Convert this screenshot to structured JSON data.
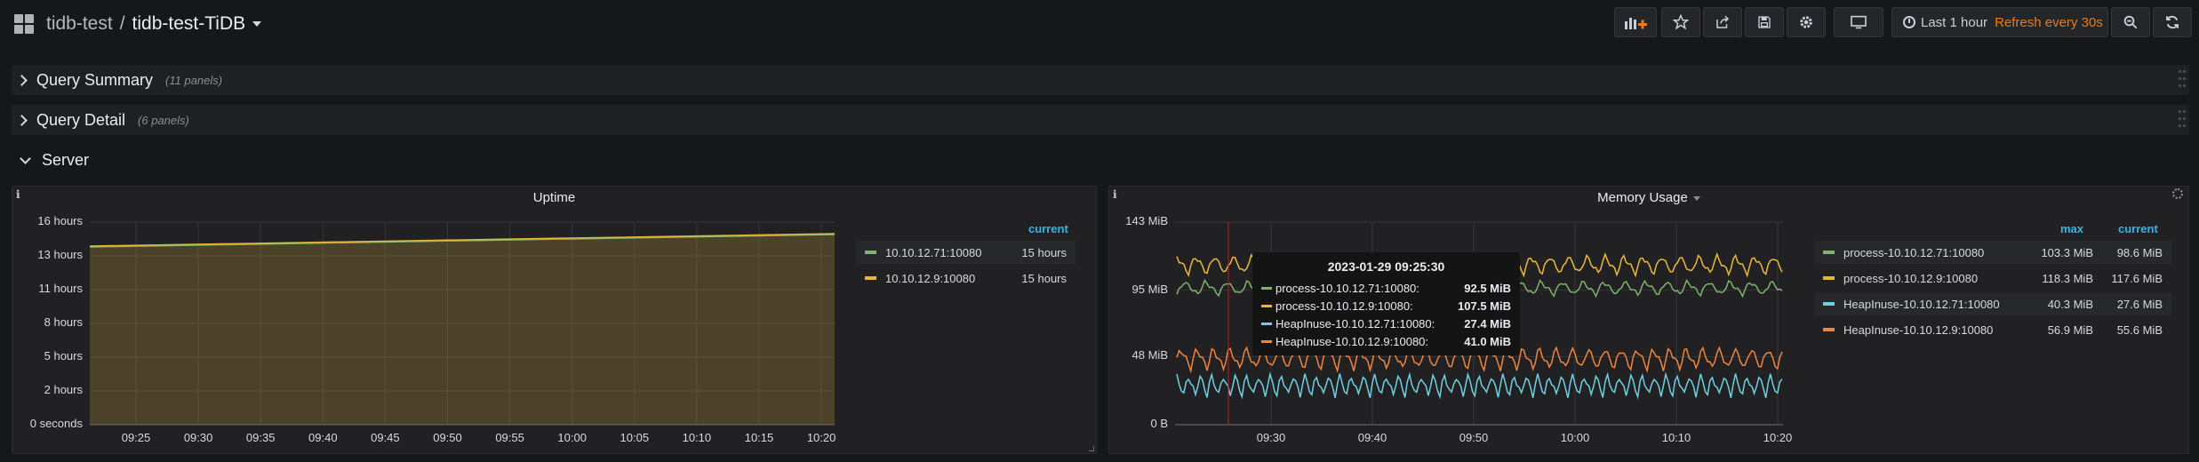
{
  "navbar": {
    "folder": "tidb-test",
    "separator": "/",
    "dashboard": "tidb-test-TiDB",
    "time_range": "Last 1 hour",
    "refresh": "Refresh every 30s",
    "buttons": [
      "add-panel-icon",
      "star-icon",
      "share-icon",
      "save-icon",
      "gear-icon",
      "tv-icon",
      "zoom-out-icon",
      "refresh-icon"
    ]
  },
  "rows": [
    {
      "title": "Query Summary",
      "count": "(11 panels)",
      "collapsed": true
    },
    {
      "title": "Query Detail",
      "count": "(6 panels)",
      "collapsed": true
    },
    {
      "title": "Server",
      "count": "",
      "collapsed": false
    }
  ],
  "uptime_panel": {
    "info": "i",
    "title": "Uptime",
    "legend_header": "current",
    "legend": [
      {
        "name": "10.10.12.71:10080",
        "current": "15 hours",
        "color": "#7eb26d"
      },
      {
        "name": "10.10.12.9:10080",
        "current": "15 hours",
        "color": "#eab839"
      }
    ],
    "y_ticks": [
      "16 hours",
      "13 hours",
      "11 hours",
      "8 hours",
      "5 hours",
      "2 hours",
      "0 seconds"
    ],
    "x_ticks": [
      "09:25",
      "09:30",
      "09:35",
      "09:40",
      "09:45",
      "09:50",
      "09:55",
      "10:00",
      "10:05",
      "10:10",
      "10:15",
      "10:20"
    ]
  },
  "memory_panel": {
    "info": "i",
    "title": "Memory Usage",
    "legend_headers": {
      "max": "max",
      "current": "current"
    },
    "legend": [
      {
        "name": "process-10.10.12.71:10080",
        "max": "103.3 MiB",
        "current": "98.6 MiB",
        "color": "#7eb26d"
      },
      {
        "name": "process-10.10.12.9:10080",
        "max": "118.3 MiB",
        "current": "117.6 MiB",
        "color": "#eab839"
      },
      {
        "name": "HeapInuse-10.10.12.71:10080",
        "max": "40.3 MiB",
        "current": "27.6 MiB",
        "color": "#6ed0e0"
      },
      {
        "name": "HeapInuse-10.10.12.9:10080",
        "max": "56.9 MiB",
        "current": "55.6 MiB",
        "color": "#ef843c"
      }
    ],
    "y_ticks": [
      "143 MiB",
      "95 MiB",
      "48 MiB",
      "0 B"
    ],
    "x_ticks": [
      "09:30",
      "09:40",
      "09:50",
      "10:00",
      "10:10",
      "10:20"
    ],
    "tooltip": {
      "time": "2023-01-29 09:25:30",
      "rows": [
        {
          "name": "process-10.10.12.71:10080:",
          "value": "92.5 MiB",
          "color": "#7eb26d"
        },
        {
          "name": "process-10.10.12.9:10080:",
          "value": "107.5 MiB",
          "color": "#eab839"
        },
        {
          "name": "HeapInuse-10.10.12.71:10080:",
          "value": "27.4 MiB",
          "color": "#6ed0e0"
        },
        {
          "name": "HeapInuse-10.10.12.9:10080:",
          "value": "41.0 MiB",
          "color": "#ef843c"
        }
      ]
    }
  }
}
